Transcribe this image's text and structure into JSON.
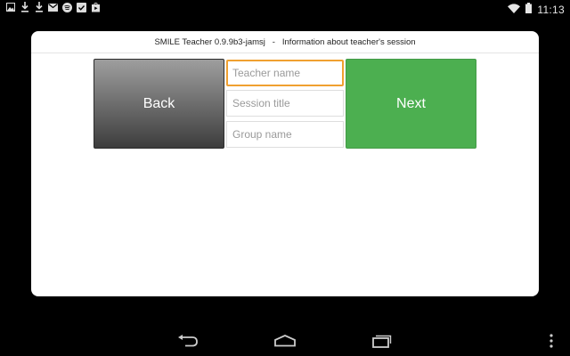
{
  "status_bar": {
    "notification_icons": [
      "image-icon",
      "download-icon",
      "download-icon",
      "gmail-icon",
      "spotify-icon",
      "task-check-icon",
      "play-store-icon"
    ],
    "time": "11:13"
  },
  "dialog": {
    "title": "SMILE Teacher 0.9.9b3-jamsj   -   Information about teacher's session",
    "back_label": "Back",
    "next_label": "Next",
    "fields": {
      "teacher_name_placeholder": "Teacher name",
      "session_title_placeholder": "Session title",
      "group_name_placeholder": "Group name"
    },
    "accent_color": "#f0a030",
    "next_color": "#4caf50"
  },
  "nav_bar": {
    "buttons": [
      "back-icon",
      "home-icon",
      "recent-apps-icon",
      "overflow-menu-icon"
    ]
  }
}
